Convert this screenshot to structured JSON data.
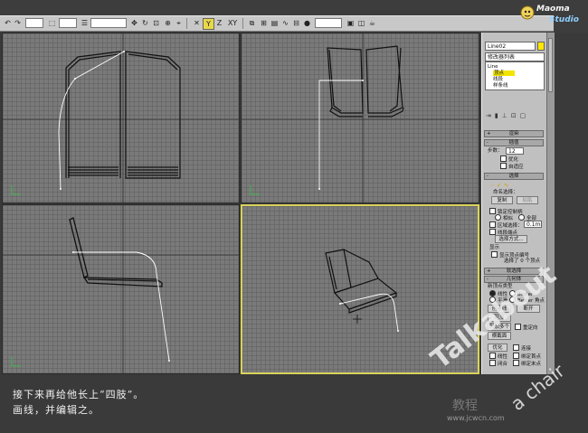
{
  "toolbar": {
    "dropdown_selection": "",
    "dropdown_filter": "",
    "dropdown_view": "",
    "dropdown_named_sel": "",
    "axis_y": "Y",
    "axis_xy": "XY"
  },
  "logo": {
    "line1": "Maoma",
    "line2": "Studio"
  },
  "viewports": [
    {
      "label": ""
    },
    {
      "label": ""
    },
    {
      "label": ""
    },
    {
      "label": ""
    }
  ],
  "panel": {
    "object_name": "Line02",
    "modifier_list": "修改器列表",
    "stack_items": [
      "Line",
      "顶点",
      "线段",
      "样条线"
    ],
    "rollout_interp": "插值",
    "rollout_render": "渲染",
    "steps_label": "步数：",
    "steps_value": "12",
    "optimize_label": "优化",
    "adaptive_label": "自适应",
    "rollout_selection": "选择",
    "named_sel_label": "命名选择：",
    "copy_btn": "复制",
    "paste_btn": "粘贴",
    "lock_handles": "锁定控制柄",
    "similar": "相似",
    "all": "全部",
    "area_select": "区域选择：",
    "area_value": "0.1mm",
    "segment_end": "线段端点",
    "select_by": "选择方式...",
    "display_label": "显示",
    "show_vertex_numbers": "显示顶点编号",
    "selected_info": "选择了 0 个顶点",
    "rollout_soft": "软选择",
    "rollout_geometry": "几何体",
    "new_vertex_type": "新顶点类型",
    "linear": "线性",
    "bezier": "Bezier",
    "smooth": "平滑",
    "bezier_corner": "Bezier 角点",
    "create_line": "创建线",
    "break": "断开",
    "attach": "附加",
    "reorient": "重定向",
    "attach_multi": "附加多个",
    "cross_section": "横截面",
    "refine": "优化",
    "connect": "连接",
    "linear2": "线性",
    "bind_first": "绑定首点",
    "closed": "闭合",
    "bind_last": "绑定末点"
  },
  "caption": {
    "line1": "接下来再给他长上“四肢”。",
    "line2": "画线，并编辑之。"
  },
  "watermark": {
    "talkabout": "Talkabout",
    "chair": "a chair",
    "site": "www.jcwcn.com",
    "cn": "教程"
  },
  "colors": {
    "viewport_bg": "#7a7a7a",
    "active_border": "#d9d35a",
    "selected_stack": "#f2e400",
    "panel_bg": "#c0c0c0"
  }
}
